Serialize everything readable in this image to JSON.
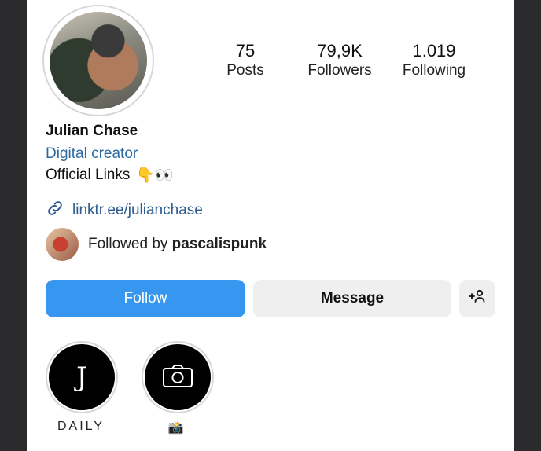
{
  "profile": {
    "name": "Julian Chase",
    "category": "Digital creator",
    "bio": "Official Links",
    "bio_emojis": "👇👀",
    "link": "linktr.ee/julianchase"
  },
  "stats": [
    {
      "value": "75",
      "label": "Posts"
    },
    {
      "value": "79,9K",
      "label": "Followers"
    },
    {
      "value": "1.019",
      "label": "Following"
    }
  ],
  "followed_by": {
    "prefix": "Followed by ",
    "username": "pascalispunk"
  },
  "actions": {
    "follow": "Follow",
    "message": "Message",
    "add_user": "+👤"
  },
  "highlights": [
    {
      "label": "DAILY",
      "icon": "J"
    },
    {
      "label": "📸",
      "icon": "camera-icon"
    }
  ],
  "colors": {
    "accent": "#3797f0",
    "link": "#2d5a8f",
    "category": "#2d6aa3"
  }
}
